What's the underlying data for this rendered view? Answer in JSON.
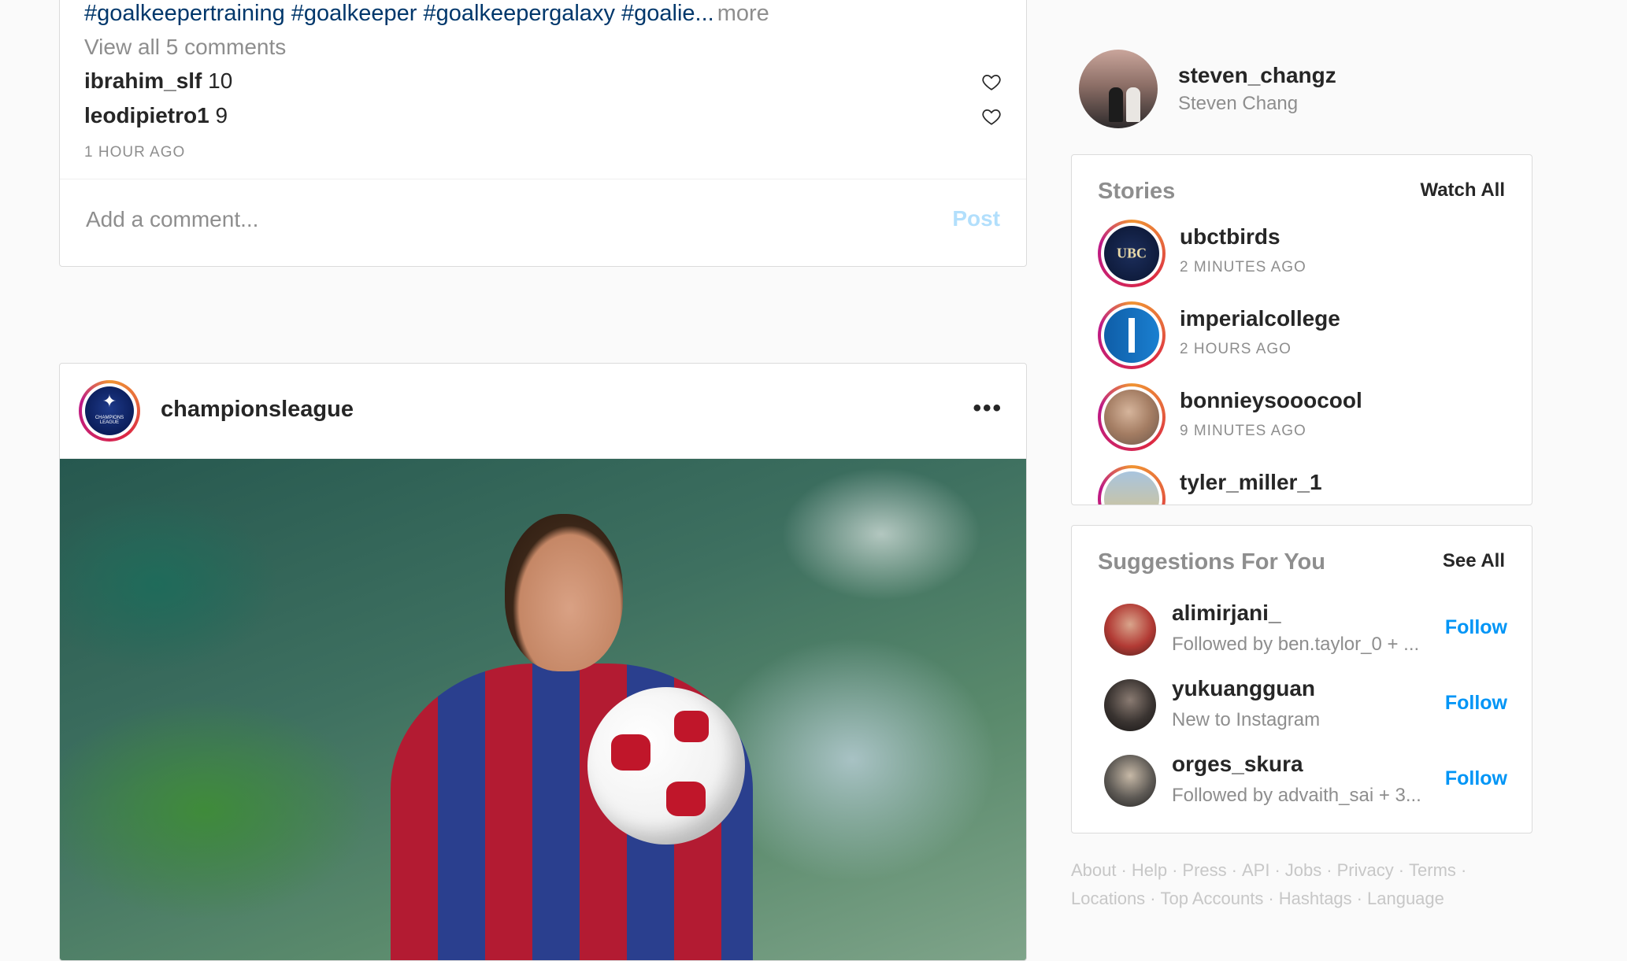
{
  "post1": {
    "caption_hashtags": "#goalkeepertraining #goalkeeper #goalkeepergalaxy #goalie...",
    "caption_more": "more",
    "view_comments": "View all 5 comments",
    "comments": [
      {
        "user": "ibrahim_slf",
        "text": "10"
      },
      {
        "user": "leodipietro1",
        "text": "9"
      }
    ],
    "timestamp": "1 HOUR AGO",
    "comment_placeholder": "Add a comment...",
    "post_label": "Post"
  },
  "post2": {
    "username": "championsleague",
    "more_label": "•••",
    "avatar_caption": "CHAMPIONS LEAGUE"
  },
  "me": {
    "username": "steven_changz",
    "fullname": "Steven Chang"
  },
  "stories": {
    "title": "Stories",
    "link": "Watch All",
    "items": [
      {
        "name": "ubctbirds",
        "time": "2 MINUTES AGO",
        "avatar_text": "UBC"
      },
      {
        "name": "imperialcollege",
        "time": "2 HOURS AGO"
      },
      {
        "name": "bonnieysooocool",
        "time": "9 MINUTES AGO"
      },
      {
        "name": "tyler_miller_1",
        "time": ""
      }
    ]
  },
  "suggestions": {
    "title": "Suggestions For You",
    "link": "See All",
    "items": [
      {
        "name": "alimirjani_",
        "sub": "Followed by ben.taylor_0 + ...",
        "action": "Follow"
      },
      {
        "name": "yukuangguan",
        "sub": "New to Instagram",
        "action": "Follow"
      },
      {
        "name": "orges_skura",
        "sub": "Followed by advaith_sai + 3...",
        "action": "Follow"
      }
    ]
  },
  "footer": {
    "links": [
      "About",
      "Help",
      "Press",
      "API",
      "Jobs",
      "Privacy",
      "Terms",
      "Locations",
      "Top Accounts",
      "Hashtags",
      "Language"
    ]
  },
  "colors": {
    "link_blue": "#0095f6",
    "hashtag_blue": "#00376b",
    "muted_gray": "#8e8e8e",
    "border": "#dbdbdb"
  }
}
